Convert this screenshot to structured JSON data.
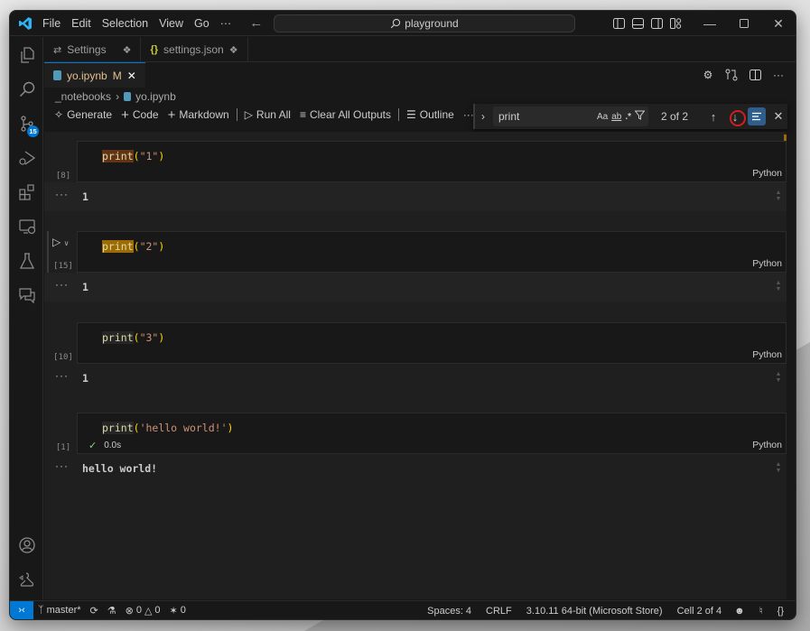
{
  "titlebar": {
    "menu": [
      "File",
      "Edit",
      "Selection",
      "View",
      "Go",
      "···"
    ],
    "search_text": "playground"
  },
  "activity_bar": {
    "items": [
      "explorer",
      "search",
      "source-control",
      "run-debug",
      "extensions",
      "remote-explorer",
      "testing",
      "chat"
    ],
    "source_control_badge": "15",
    "bottom": [
      "accounts",
      "manage"
    ]
  },
  "tabs_row1": [
    {
      "label": "Settings",
      "pinned": true
    },
    {
      "label": "settings.json",
      "pinned": true
    }
  ],
  "tabs_row2": [
    {
      "label": "yo.ipynb",
      "modified": "M",
      "active": true
    }
  ],
  "breadcrumb": [
    "_notebooks",
    "yo.ipynb"
  ],
  "notebook_toolbar": {
    "generate": "Generate",
    "code": "Code",
    "markdown": "Markdown",
    "run_all": "Run All",
    "clear_all": "Clear All Outputs",
    "outline": "Outline",
    "more": "···"
  },
  "find": {
    "query": "print",
    "opt_case": "Aa",
    "opt_word": "ab",
    "opt_regex": ".*",
    "count": "2 of 2"
  },
  "cells": [
    {
      "exec": "[8]",
      "fn": "print",
      "open": "(",
      "arg": "\"1\"",
      "close": ")",
      "lang": "Python",
      "output": "1"
    },
    {
      "exec": "[15]",
      "fn": "print",
      "open": "(",
      "arg": "\"2\"",
      "close": ")",
      "lang": "Python",
      "output": "1"
    },
    {
      "exec": "[10]",
      "fn": "print",
      "open": "(",
      "arg": "\"3\"",
      "close": ")",
      "lang": "Python",
      "output": "1"
    },
    {
      "exec": "[1]",
      "fn": "print",
      "open": "(",
      "arg": "'hello world!'",
      "close": ")",
      "lang": "Python",
      "output": "hello world!",
      "duration": "0.0s"
    }
  ],
  "statusbar": {
    "branch": "master*",
    "errors": "0",
    "warnings": "0",
    "ports": "0",
    "spaces": "Spaces: 4",
    "eol": "CRLF",
    "interpreter": "3.10.11 64-bit (Microsoft Store)",
    "cell_pos": "Cell 2 of 4"
  },
  "colors": {
    "accent": "#0078d4",
    "match_current": "#9e6a03",
    "match_other": "#623315"
  }
}
